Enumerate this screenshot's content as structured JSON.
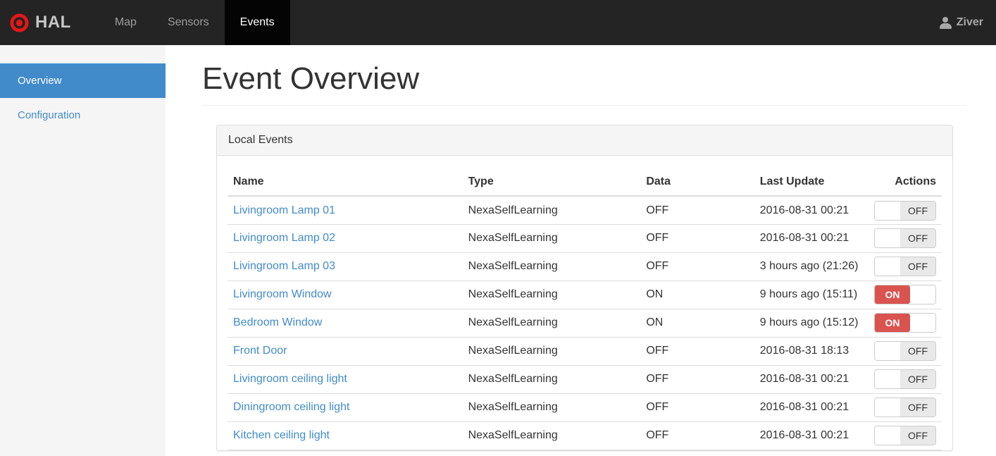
{
  "navbar": {
    "brand": "HAL",
    "items": [
      {
        "label": "Map",
        "active": false
      },
      {
        "label": "Sensors",
        "active": false
      },
      {
        "label": "Events",
        "active": true
      }
    ],
    "user": "Ziver"
  },
  "sidebar": {
    "items": [
      {
        "label": "Overview",
        "active": true
      },
      {
        "label": "Configuration",
        "active": false
      }
    ]
  },
  "page": {
    "title": "Event Overview"
  },
  "panel": {
    "title": "Local Events",
    "table": {
      "columns": [
        "Name",
        "Type",
        "Data",
        "Last Update",
        "Actions"
      ],
      "rows": [
        {
          "name": "Livingroom Lamp 01",
          "type": "NexaSelfLearning",
          "data": "OFF",
          "last_update": "2016-08-31 00:21",
          "action": "OFF"
        },
        {
          "name": "Livingroom Lamp 02",
          "type": "NexaSelfLearning",
          "data": "OFF",
          "last_update": "2016-08-31 00:21",
          "action": "OFF"
        },
        {
          "name": "Livingroom Lamp 03",
          "type": "NexaSelfLearning",
          "data": "OFF",
          "last_update": "3 hours ago (21:26)",
          "action": "OFF"
        },
        {
          "name": "Livingroom Window",
          "type": "NexaSelfLearning",
          "data": "ON",
          "last_update": "9 hours ago (15:11)",
          "action": "ON"
        },
        {
          "name": "Bedroom Window",
          "type": "NexaSelfLearning",
          "data": "ON",
          "last_update": "9 hours ago (15:12)",
          "action": "ON"
        },
        {
          "name": "Front Door",
          "type": "NexaSelfLearning",
          "data": "OFF",
          "last_update": "2016-08-31 18:13",
          "action": "OFF"
        },
        {
          "name": "Livingroom ceiling light",
          "type": "NexaSelfLearning",
          "data": "OFF",
          "last_update": "2016-08-31 00:21",
          "action": "OFF"
        },
        {
          "name": "Diningroom ceiling light",
          "type": "NexaSelfLearning",
          "data": "OFF",
          "last_update": "2016-08-31 00:21",
          "action": "OFF"
        },
        {
          "name": "Kitchen ceiling light",
          "type": "NexaSelfLearning",
          "data": "OFF",
          "last_update": "2016-08-31 00:21",
          "action": "OFF"
        }
      ]
    }
  },
  "colors": {
    "accent_blue": "#428bca",
    "switch_on_red": "#d9534f",
    "navbar_bg": "#242424",
    "sidebar_bg": "#f5f5f5",
    "logo_red": "#e61717"
  }
}
